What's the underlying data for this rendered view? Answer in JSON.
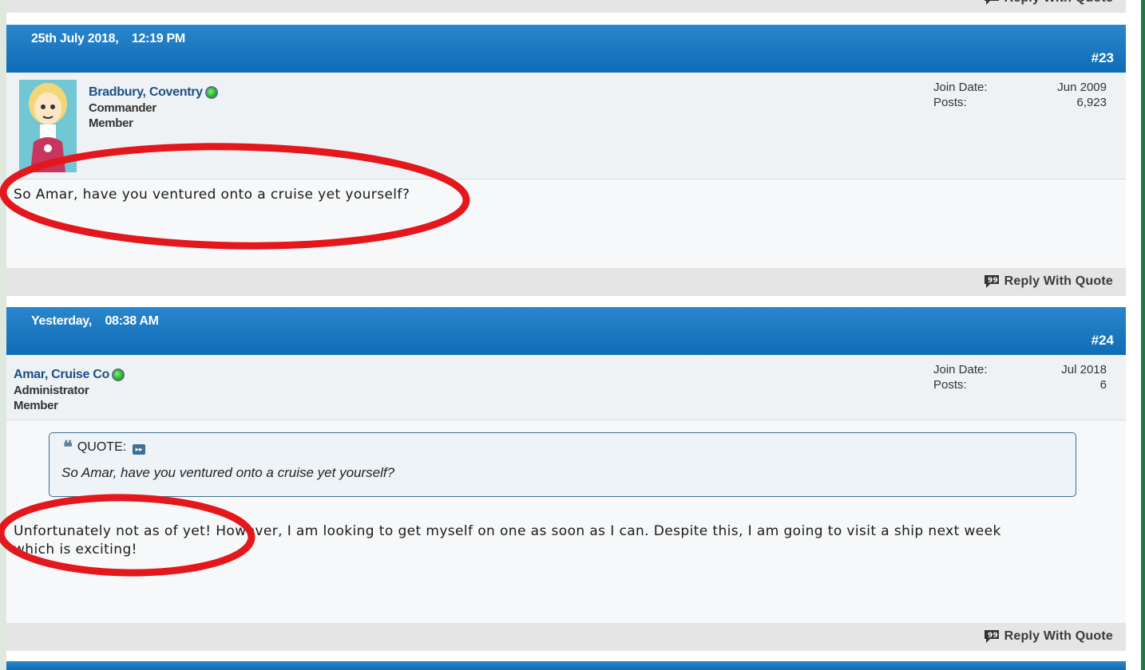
{
  "reply_label": "Reply With Quote",
  "colors": {
    "header_blue": "#0f6cb5",
    "annotation_red": "#e3171c",
    "online_green": "#2dbd2d"
  },
  "posts": [
    {
      "date": "25th July 2018,    12:19 PM",
      "number": "#23",
      "username": "Bradbury, Coventry",
      "rank_line1": "Commander",
      "rank_line2": "Member",
      "join_label": "Join Date:",
      "join_value": "Jun 2009",
      "posts_label": "Posts:",
      "posts_value": "6,923",
      "body": "So Amar, have you ventured onto a cruise yet yourself?"
    },
    {
      "date": "Yesterday,    08:38 AM",
      "number": "#24",
      "username": "Amar, Cruise Co",
      "rank_line1": "Administrator",
      "rank_line2": "Member",
      "join_label": "Join Date:",
      "join_value": "Jul 2018",
      "posts_label": "Posts:",
      "posts_value": "6",
      "quote_label": "QUOTE:",
      "quote_text": "So Amar, have you ventured onto a cruise yet yourself?",
      "body_line1": "Unfortunately not as of yet! However, I am looking to get myself on one as soon as I can. Despite this, I am going to visit a ship next week",
      "body_line2": "which is exciting!"
    }
  ]
}
